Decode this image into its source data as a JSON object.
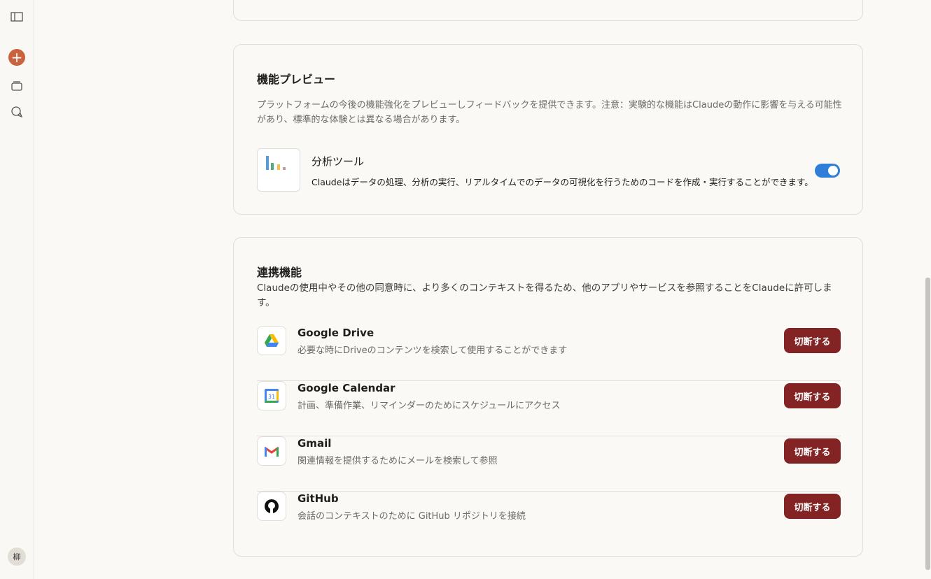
{
  "sidebar": {
    "avatar": "柳"
  },
  "preview": {
    "title": "機能プレビュー",
    "description": "プラットフォームの今後の機能強化をプレビューしフィードバックを提供できます。注意：実験的な機能はClaudeの動作に影響を与える可能性があり、標準的な体験とは異なる場合があります。",
    "feature": {
      "name": "分析ツール",
      "description": "Claudeはデータの処理、分析の実行、リアルタイムでのデータの可視化を行うためのコードを作成・実行することができます。",
      "enabled": true
    }
  },
  "integrations": {
    "title": "連携機能",
    "description": "Claudeの使用中やその他の同意時に、より多くのコンテキストを得るため、他のアプリやサービスを参照することをClaudeに許可します。",
    "items": [
      {
        "name": "Google Drive",
        "description": "必要な時にDriveのコンテンツを検索して使用することができます",
        "button": "切断する"
      },
      {
        "name": "Google Calendar",
        "description": "計画、準備作業、リマインダーのためにスケジュールにアクセス",
        "button": "切断する"
      },
      {
        "name": "Gmail",
        "description": "関連情報を提供するためにメールを検索して参照",
        "button": "切断する"
      },
      {
        "name": "GitHub",
        "description": "会話のコンテキストのために GitHub リポジトリを接続",
        "button": "切断する"
      }
    ]
  },
  "colors": {
    "accent": "#c9623f",
    "disconnect": "#832323",
    "toggle": "#2f7ed8"
  }
}
